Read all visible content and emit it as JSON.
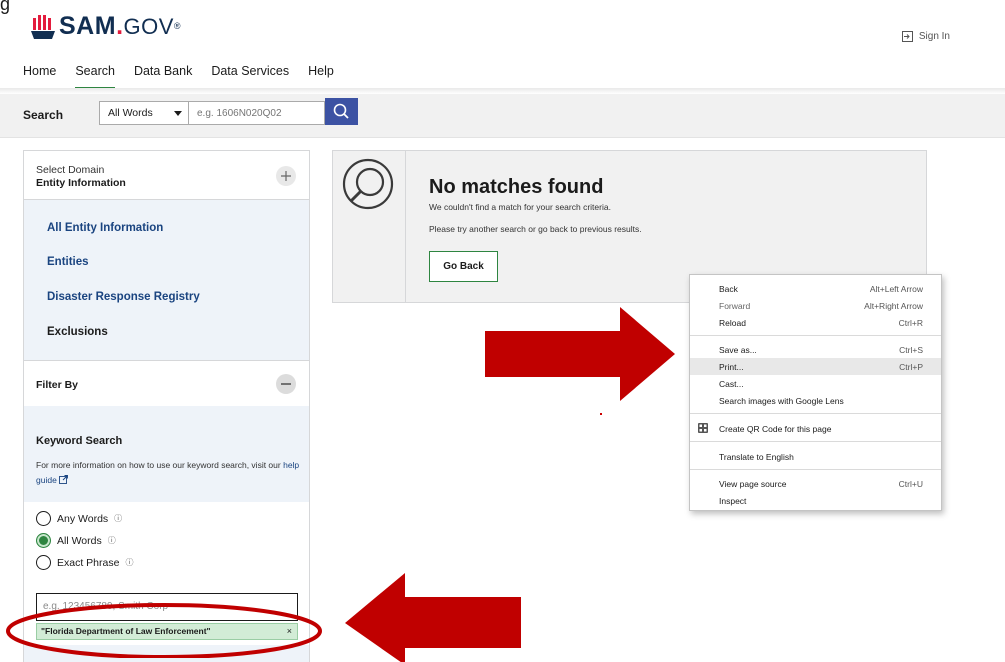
{
  "header": {
    "top_fragment": "g",
    "logo": {
      "text_main": "SAM",
      "text_dot": ".",
      "text_gov": "GOV",
      "trademark": "®"
    },
    "signin_label": "Sign In"
  },
  "nav": {
    "items": [
      {
        "label": "Home",
        "active": false
      },
      {
        "label": "Search",
        "active": true
      },
      {
        "label": "Data Bank",
        "active": false
      },
      {
        "label": "Data Services",
        "active": false
      },
      {
        "label": "Help",
        "active": false
      }
    ]
  },
  "search": {
    "label": "Search",
    "mode_selected": "All Words",
    "placeholder": "e.g. 1606N020Q02"
  },
  "sidebar": {
    "domain": {
      "title": "Select Domain",
      "value": "Entity Information"
    },
    "domain_items": [
      {
        "label": "All Entity Information",
        "link": true
      },
      {
        "label": "Entities",
        "link": true
      },
      {
        "label": "Disaster Response Registry",
        "link": true
      },
      {
        "label": "Exclusions",
        "link": false
      }
    ],
    "filter_title": "Filter By",
    "keyword": {
      "title": "Keyword Search",
      "desc": "For more information on how to use our keyword search, visit our",
      "help_link": "help guide",
      "options": [
        {
          "label": "Any Words",
          "selected": false
        },
        {
          "label": "All Words",
          "selected": true
        },
        {
          "label": "Exact Phrase",
          "selected": false
        }
      ],
      "input_placeholder": "e.g. 123456789, Smith Corp",
      "chip_text": "\"Florida Department of Law Enforcement\"",
      "chip_close": "×"
    }
  },
  "results": {
    "title": "No matches found",
    "message_1": "We couldn't find a match for your search criteria.",
    "message_2": "Please try another search or go back to previous results.",
    "go_back_label": "Go Back"
  },
  "context_menu": {
    "items": [
      {
        "label": "Back",
        "shortcut": "Alt+Left Arrow",
        "disabled": false
      },
      {
        "label": "Forward",
        "shortcut": "Alt+Right Arrow",
        "disabled": true
      },
      {
        "label": "Reload",
        "shortcut": "Ctrl+R",
        "disabled": false
      },
      {
        "label": "Save as...",
        "shortcut": "Ctrl+S",
        "disabled": false
      },
      {
        "label": "Print...",
        "shortcut": "Ctrl+P",
        "disabled": false,
        "highlighted": true
      },
      {
        "label": "Cast...",
        "shortcut": "",
        "disabled": false
      },
      {
        "label": "Search images with Google Lens",
        "shortcut": "",
        "disabled": false
      },
      {
        "label": "Create QR Code for this page",
        "shortcut": "",
        "disabled": false
      },
      {
        "label": "Translate to English",
        "shortcut": "",
        "disabled": false
      },
      {
        "label": "View page source",
        "shortcut": "Ctrl+U",
        "disabled": false
      },
      {
        "label": "Inspect",
        "shortcut": "",
        "disabled": false
      }
    ]
  },
  "colors": {
    "brand_navy": "#112e51",
    "accent_green": "#2e8540",
    "link_blue": "#1a4480",
    "search_button": "#3c52a3",
    "annotation_red": "#c00000"
  },
  "icons": {
    "search": "magnifier-icon",
    "signin": "sign-in-icon",
    "expand": "plus-icon",
    "collapse": "minus-icon",
    "external": "external-link-icon",
    "info": "info-icon",
    "qr": "qr-code-icon"
  }
}
